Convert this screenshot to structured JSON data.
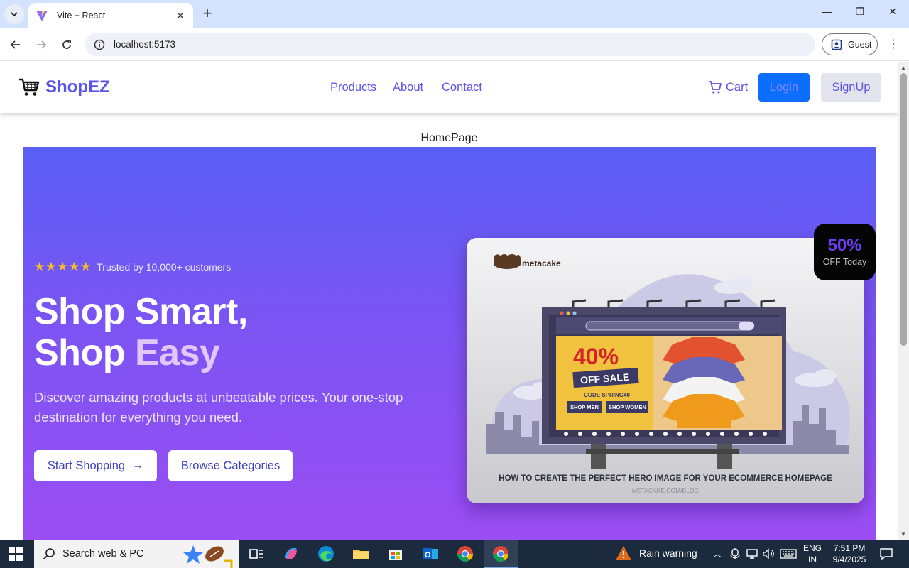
{
  "browser": {
    "tab_title": "Vite + React",
    "url": "localhost:5173",
    "profile_label": "Guest"
  },
  "site": {
    "brand": "ShopEZ",
    "nav": [
      "Products",
      "About",
      "Contact"
    ],
    "cart_label": "Cart",
    "login_label": "Login",
    "signup_label": "SignUp",
    "page_label": "HomePage"
  },
  "hero": {
    "rating_stars": 5,
    "trust_text": "Trusted by 10,000+ customers",
    "headline_line1": "Shop Smart,",
    "headline_line2_a": "Shop",
    "headline_line2_b": "Easy",
    "subtext": "Discover amazing products at unbeatable prices. Your one-stop destination for everything you need.",
    "primary_button": "Start Shopping",
    "secondary_button": "Browse Categories",
    "badge_value": "50%",
    "badge_sub": "OFF Today",
    "image": {
      "logo_text": "metacake",
      "sale_big": "40%",
      "sale_ribbon": "OFF SALE",
      "code": "CODE SPRING40",
      "btn_men": "SHOP MEN",
      "btn_women": "SHOP WOMEN",
      "caption": "HOW TO CREATE THE PERFECT HERO IMAGE FOR YOUR ECOMMERCE HOMEPAGE",
      "caption_sub": "METACAKE.COM/BLOG"
    }
  },
  "taskbar": {
    "search_placeholder": "Search web & PC",
    "weather": "Rain warning",
    "lang_top": "ENG",
    "lang_bottom": "IN",
    "time": "7:51 PM",
    "date": "9/4/2025"
  },
  "colors": {
    "brand": "#5b54e8",
    "login_bg": "#0d6efd",
    "hero_top": "#5a5ff5",
    "hero_bottom": "#9b4df2",
    "star": "#fbbf24"
  }
}
